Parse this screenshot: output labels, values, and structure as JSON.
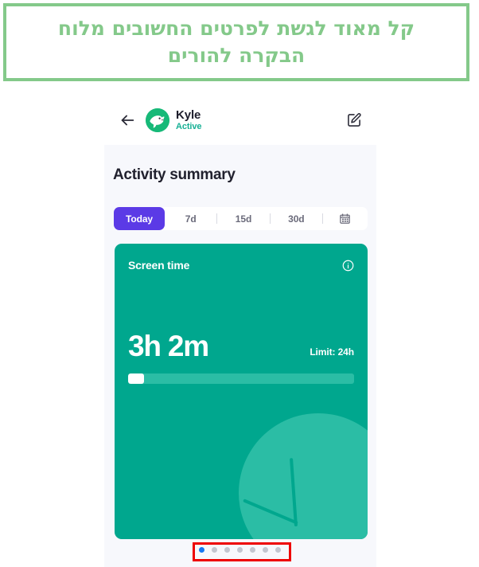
{
  "caption": {
    "line1": "קל מאוד לגשת לפרטים החשובים מלוח",
    "line2": "הבקרה להורים",
    "border_color": "#84c98a",
    "text_color": "#84c98a"
  },
  "app_header": {
    "back_icon": "arrow-left-icon",
    "avatar_icon": "whale-avatar-icon",
    "profile_name": "Kyle",
    "profile_status": "Active",
    "status_color": "#17b095",
    "edit_icon": "edit-pencil-icon"
  },
  "summary": {
    "title": "Activity summary",
    "tabs": [
      {
        "label": "Today",
        "active": true
      },
      {
        "label": "7d",
        "active": false
      },
      {
        "label": "15d",
        "active": false
      },
      {
        "label": "30d",
        "active": false
      }
    ],
    "calendar_icon": "calendar-icon",
    "active_tab_color": "#5b3ae6"
  },
  "screen_time_card": {
    "title": "Screen time",
    "info_icon": "info-circle-icon",
    "value": "3h 2m",
    "limit_label": "Limit: 24h",
    "progress_percent": 7,
    "card_color": "#00a78e",
    "decoration_icon": "clock-icon"
  },
  "pagination": {
    "total": 7,
    "active_index": 0,
    "active_color": "#1878f2",
    "inactive_color": "#c4c6d0"
  },
  "annotation": {
    "color": "#ee0000"
  }
}
